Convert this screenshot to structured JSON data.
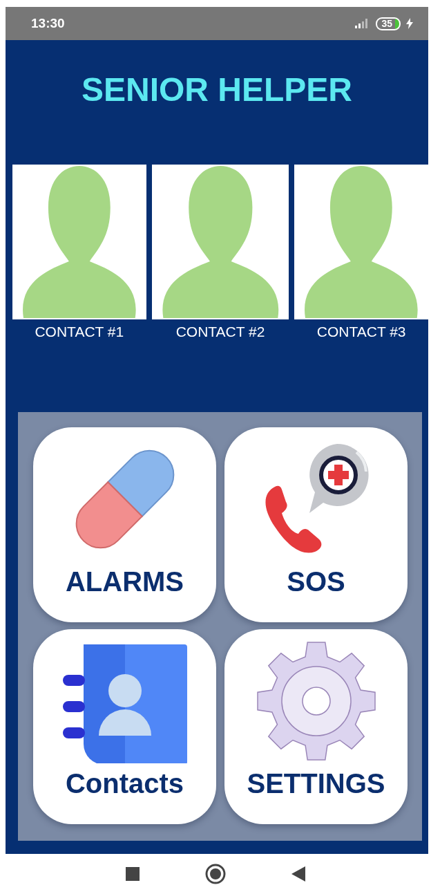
{
  "status_bar": {
    "time": "13:30",
    "battery": "35"
  },
  "app": {
    "title": "SENIOR HELPER"
  },
  "contacts": [
    {
      "label": "CONTACT #1"
    },
    {
      "label": "CONTACT #2"
    },
    {
      "label": "CONTACT #3"
    }
  ],
  "tiles": [
    {
      "kind": "pill",
      "label": "ALARMS"
    },
    {
      "kind": "sos",
      "label": "SOS"
    },
    {
      "kind": "book",
      "label": "Contacts"
    },
    {
      "kind": "gear",
      "label": "SETTINGS"
    }
  ]
}
